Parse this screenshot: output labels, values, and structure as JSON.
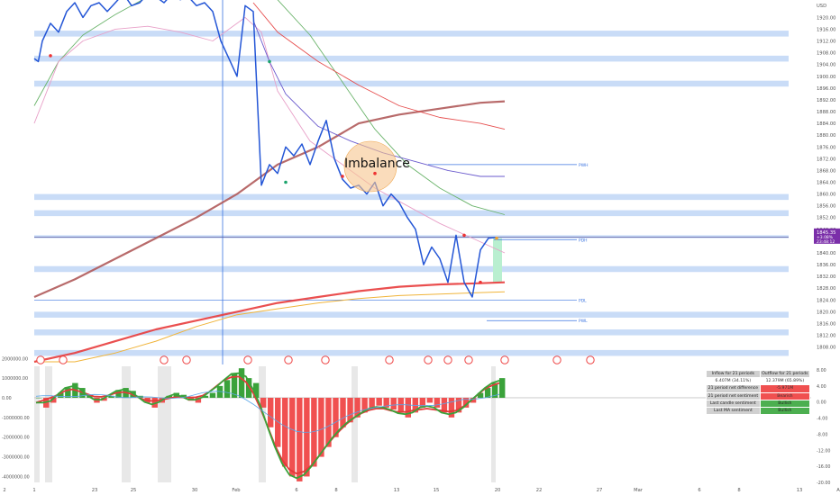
{
  "symbol_currency": "USD",
  "price_label": {
    "value": "1845.35",
    "change": "+3.08%",
    "time": "23:48:12"
  },
  "annotations": {
    "imbalance": "Imbalance",
    "pdh": "PDH",
    "pdl": "PDL",
    "pwh": "PWH",
    "pwl": "PWL"
  },
  "chart_data": {
    "type": "line",
    "main": {
      "ylim": [
        1803,
        1925
      ],
      "y_ticks": [
        "1920.00",
        "1916.00",
        "1912.00",
        "1908.00",
        "1904.00",
        "1900.00",
        "1896.00",
        "1892.00",
        "1888.00",
        "1884.00",
        "1880.00",
        "1876.00",
        "1872.00",
        "1868.00",
        "1864.00",
        "1860.00",
        "1856.00",
        "1852.00",
        "1848.00",
        "1844.00",
        "1840.00",
        "1836.00",
        "1832.00",
        "1828.00",
        "1824.00",
        "1820.00",
        "1816.00",
        "1812.00",
        "1808.00"
      ],
      "y_tick_values": [
        1920,
        1916,
        1912,
        1908,
        1904,
        1900,
        1896,
        1892,
        1888,
        1884,
        1880,
        1876,
        1872,
        1868,
        1864,
        1860,
        1856,
        1852,
        1848,
        1844,
        1840,
        1836,
        1832,
        1828,
        1824,
        1820,
        1816,
        1812,
        1808
      ],
      "x_ticks": [
        "2",
        "1",
        "23",
        "25",
        "30",
        "Feb",
        "6",
        "8",
        "13",
        "15",
        "20",
        "22",
        "27",
        "Mar",
        "6",
        "8",
        "13",
        "A"
      ],
      "zones": [
        [
          1913.5,
          1915.5
        ],
        [
          1905,
          1907
        ],
        [
          1896.5,
          1898.5
        ],
        [
          1858,
          1860
        ],
        [
          1852.5,
          1854.5
        ],
        [
          1845,
          1846
        ],
        [
          1833.5,
          1835.5
        ],
        [
          1818,
          1820
        ],
        [
          1812,
          1814
        ],
        [
          1805,
          1807
        ]
      ],
      "price": {
        "x": [
          0,
          0.5,
          1,
          2,
          3,
          4,
          5,
          6,
          7,
          8,
          9,
          10,
          11,
          12,
          13,
          14,
          15,
          16,
          17,
          18,
          19,
          20,
          21,
          22,
          23,
          24,
          25,
          26,
          27,
          28,
          29,
          30,
          31,
          32,
          33,
          34,
          35,
          36,
          37,
          38,
          39,
          40,
          41,
          42,
          43,
          44,
          45,
          46,
          47,
          48,
          49,
          50,
          51,
          52,
          53,
          54,
          55,
          56,
          57
        ],
        "y": [
          1906,
          1905,
          1912,
          1918,
          1915,
          1922,
          1925,
          1920,
          1924,
          1925,
          1922,
          1925,
          1928,
          1924,
          1925,
          1928,
          1927,
          1925,
          1928,
          1926,
          1927,
          1924,
          1925,
          1922,
          1912,
          1906,
          1900,
          1924,
          1922,
          1863,
          1870,
          1867,
          1876,
          1873,
          1877,
          1870,
          1878,
          1885,
          1872,
          1865,
          1862,
          1863,
          1860,
          1864,
          1856,
          1860,
          1857,
          1852,
          1848,
          1836,
          1842,
          1838,
          1830,
          1846,
          1830,
          1825,
          1841,
          1845,
          1845.3
        ]
      },
      "ma_red_thick": {
        "x": [
          0,
          5,
          10,
          15,
          20,
          25,
          30,
          35,
          40,
          45,
          50,
          55,
          58
        ],
        "y": [
          1825,
          1831,
          1838,
          1845,
          1852,
          1860,
          1870,
          1876,
          1884,
          1887,
          1889,
          1891,
          1891.5
        ]
      },
      "ma_green": {
        "x": [
          0,
          3,
          6,
          10,
          14,
          18,
          22,
          26,
          30,
          34,
          38,
          42,
          46,
          50,
          54,
          58
        ],
        "y": [
          1890,
          1905,
          1914,
          1921,
          1927,
          1931,
          1932,
          1930,
          1926,
          1914,
          1898,
          1882,
          1870,
          1862,
          1856,
          1853
        ]
      },
      "ma_pink": {
        "x": [
          0,
          3,
          6,
          10,
          14,
          18,
          22,
          26,
          28,
          30,
          34,
          38,
          42,
          46,
          50,
          54,
          58
        ],
        "y": [
          1884,
          1905,
          1912,
          1916,
          1917,
          1915,
          1912,
          1920,
          1915,
          1895,
          1878,
          1870,
          1862,
          1856,
          1850,
          1845,
          1840
        ]
      },
      "ma_purple": {
        "x": [
          27,
          29,
          31,
          35,
          39,
          43,
          47,
          51,
          55,
          58
        ],
        "y": [
          1919,
          1905,
          1894,
          1883,
          1878,
          1874,
          1871,
          1868,
          1866,
          1866
        ]
      },
      "ma_bright_red": {
        "x": [
          27,
          30,
          35,
          40,
          45,
          50,
          55,
          58
        ],
        "y": [
          1925,
          1915,
          1905,
          1897,
          1890,
          1886,
          1884,
          1882
        ]
      },
      "ma_thick_red2": {
        "x": [
          0,
          5,
          10,
          15,
          20,
          25,
          30,
          35,
          40,
          45,
          50,
          55,
          58
        ],
        "y": [
          1803,
          1806,
          1810,
          1814,
          1817,
          1820,
          1823,
          1825,
          1827,
          1828.5,
          1829.3,
          1829.7,
          1830
        ]
      },
      "ma_orange": {
        "x": [
          0,
          5,
          10,
          15,
          20,
          25,
          30,
          35,
          40,
          45,
          50,
          55,
          58
        ],
        "y": [
          1803,
          1803,
          1806,
          1810,
          1815,
          1819,
          1821,
          1823,
          1824.5,
          1825.5,
          1826,
          1826.5,
          1826.8
        ]
      }
    },
    "osc": {
      "ylim": [
        -4300000,
        1600000
      ],
      "left_ticks": [
        "2000000.00",
        "1000000.00",
        "0.00",
        "-1000000.00",
        "-2000000.00",
        "-3000000.00",
        "-4000000.00"
      ],
      "left_tick_values": [
        2000000,
        1000000,
        0,
        -1000000,
        -2000000,
        -3000000,
        -4000000
      ],
      "right_ticks": [
        "8.00",
        "4.00",
        "0.00",
        "-4.00",
        "-8.00",
        "-12.00",
        "-16.00",
        "-20.00"
      ],
      "bars": [
        0,
        -1,
        -0.5,
        0.5,
        1,
        1.5,
        1,
        0.3,
        -0.5,
        -0.3,
        0.2,
        0.8,
        1,
        0.7,
        0.2,
        -0.5,
        -1,
        -0.5,
        0.2,
        0.5,
        0.3,
        -0.3,
        -0.5,
        0.2,
        0.5,
        1.2,
        1.8,
        2.5,
        3,
        2,
        1.5,
        -1,
        -3,
        -5,
        -7,
        -8,
        -8.5,
        -8,
        -7,
        -6,
        -5,
        -4,
        -3,
        -2.5,
        -2,
        -1.5,
        -1,
        -0.8,
        -1,
        -1.2,
        -1.5,
        -2,
        -1.5,
        -1,
        -0.5,
        -1,
        -1.5,
        -2,
        -1.5,
        -1,
        -0.5,
        0.5,
        1,
        1.5,
        2
      ]
    },
    "stats": {
      "headers": [
        "Inflow for 21 periods",
        "Outflow for 21 periods"
      ],
      "values": [
        "6.407M (34.11%)",
        "12.379M (65.89%)"
      ],
      "rows": [
        {
          "label": "21 period net difference",
          "value": "-5.971M",
          "color": "red"
        },
        {
          "label": "21 period net sentiment",
          "value": "Bearish",
          "color": "red"
        },
        {
          "label": "Last candle sentiment",
          "value": "Bullish",
          "color": "green"
        },
        {
          "label": "Last MA sentiment",
          "value": "Bullish",
          "color": "green"
        }
      ]
    }
  }
}
